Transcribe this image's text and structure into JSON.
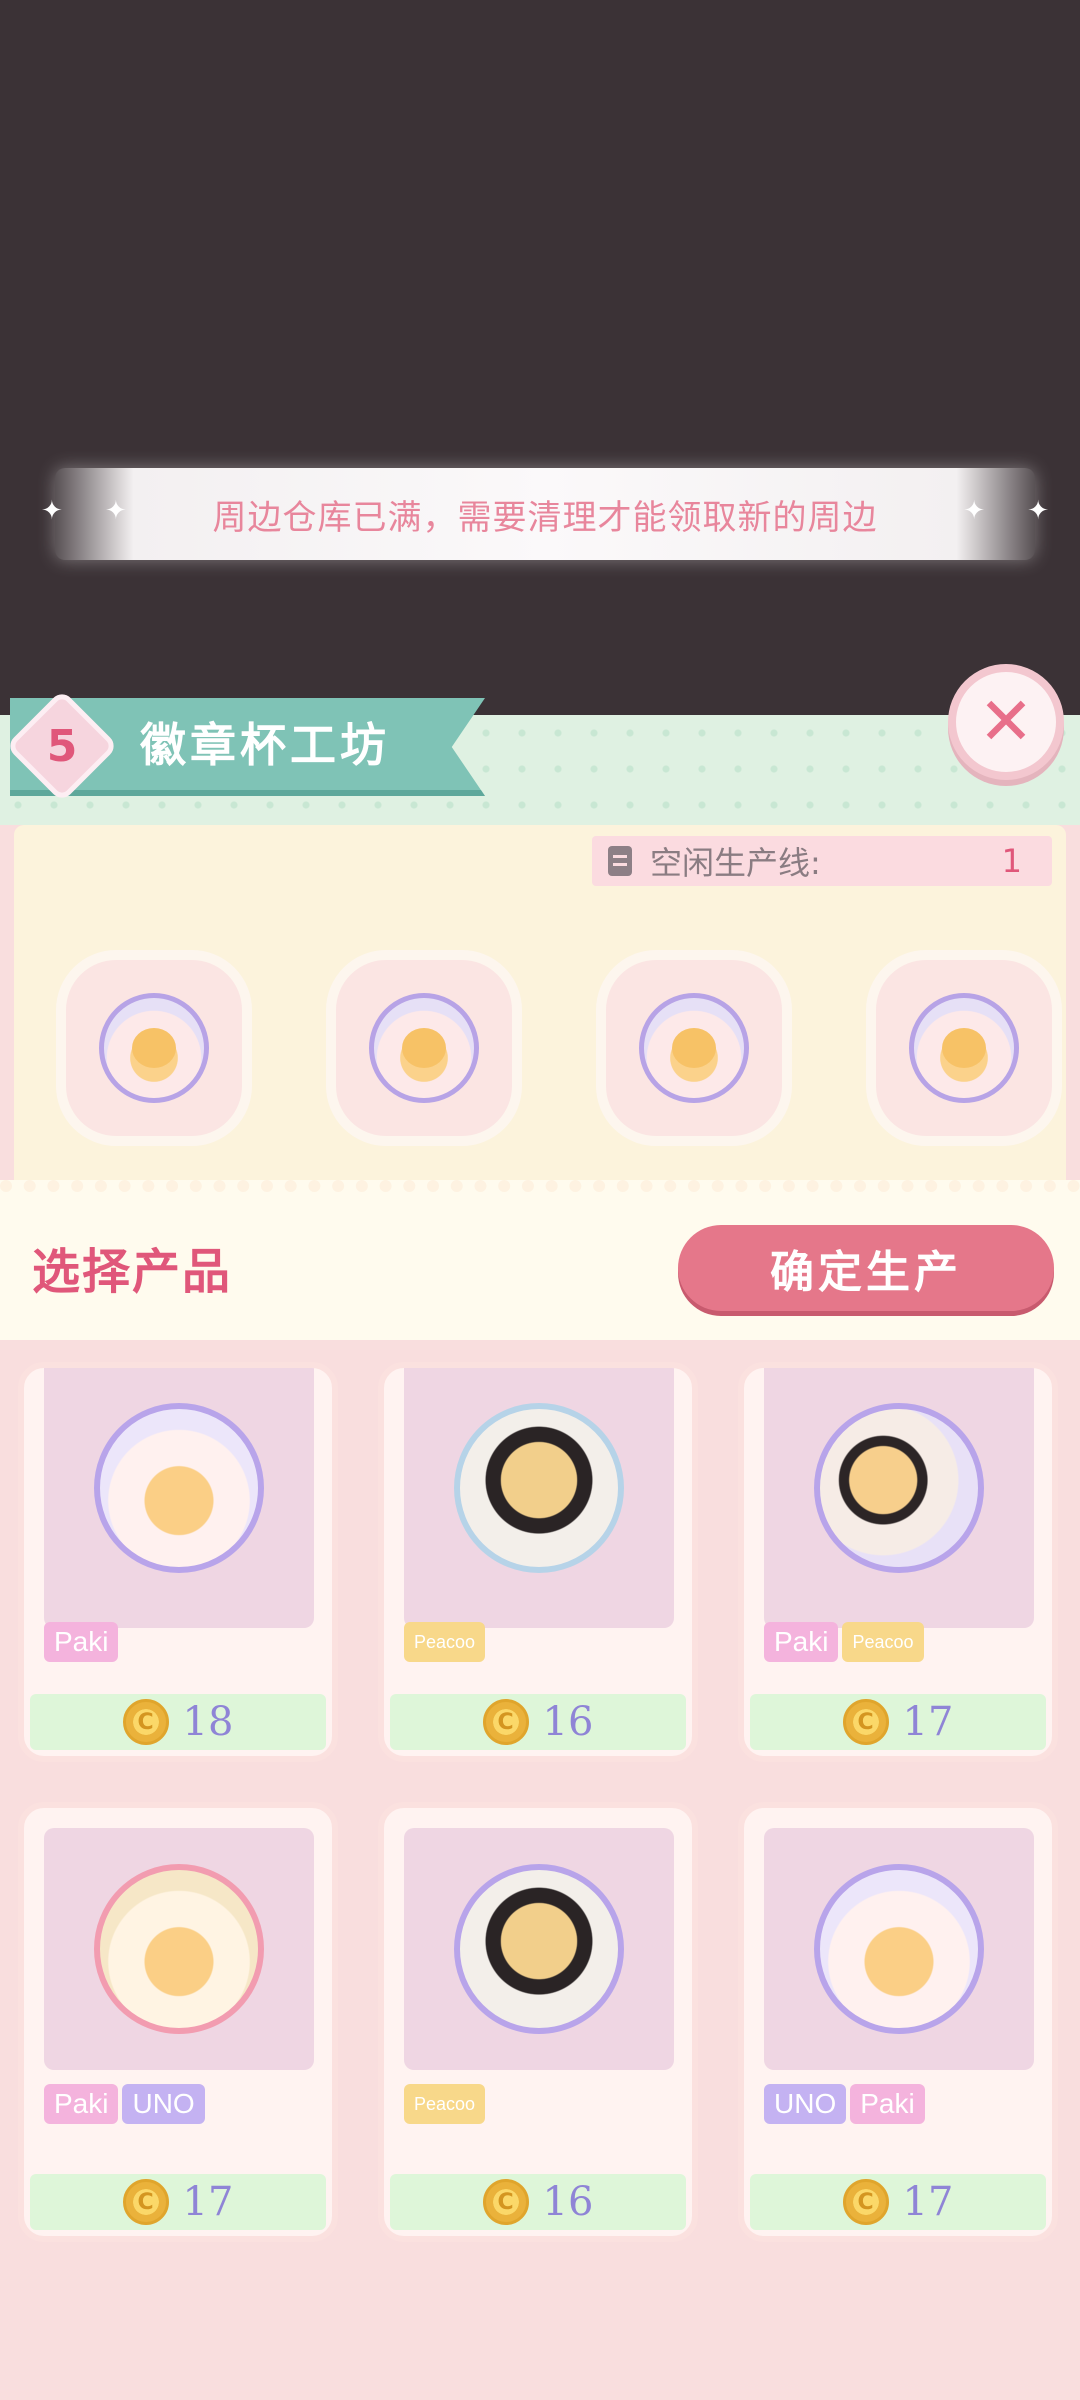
{
  "toast": {
    "message": "周边仓库已满，需要清理才能领取新的周边"
  },
  "workshop": {
    "level": "5",
    "title": "徽章杯工坊",
    "idle_lines_label": "空闲生产线:",
    "idle_lines_count": "1",
    "slots": [
      "badge-paki-uno",
      "badge-paki",
      "badge-paki-uno",
      "badge-paki"
    ]
  },
  "select": {
    "title": "选择产品",
    "confirm_label": "确定生产"
  },
  "products": [
    {
      "tags": [
        "Paki"
      ],
      "price": "18",
      "style": "default"
    },
    {
      "tags": [
        "Peacoo"
      ],
      "price": "16",
      "style": "peacoo"
    },
    {
      "tags": [
        "Paki",
        "Peacoo"
      ],
      "price": "17",
      "style": "combo"
    },
    {
      "tags": [
        "Paki",
        "UNO"
      ],
      "price": "17",
      "style": "pink"
    },
    {
      "tags": [
        "Peacoo"
      ],
      "price": "16",
      "style": "peacoo"
    },
    {
      "tags": [
        "UNO",
        "Paki"
      ],
      "price": "17",
      "style": "default"
    }
  ],
  "colors": {
    "accent": "#e0577a",
    "ribbon": "#7fc3b6",
    "confirm": "#e5778a",
    "price": "#8f84d6"
  },
  "icons": {
    "close": "close-icon",
    "coin": "coin-icon",
    "list": "list-icon",
    "sparkle": "sparkle-icon"
  }
}
